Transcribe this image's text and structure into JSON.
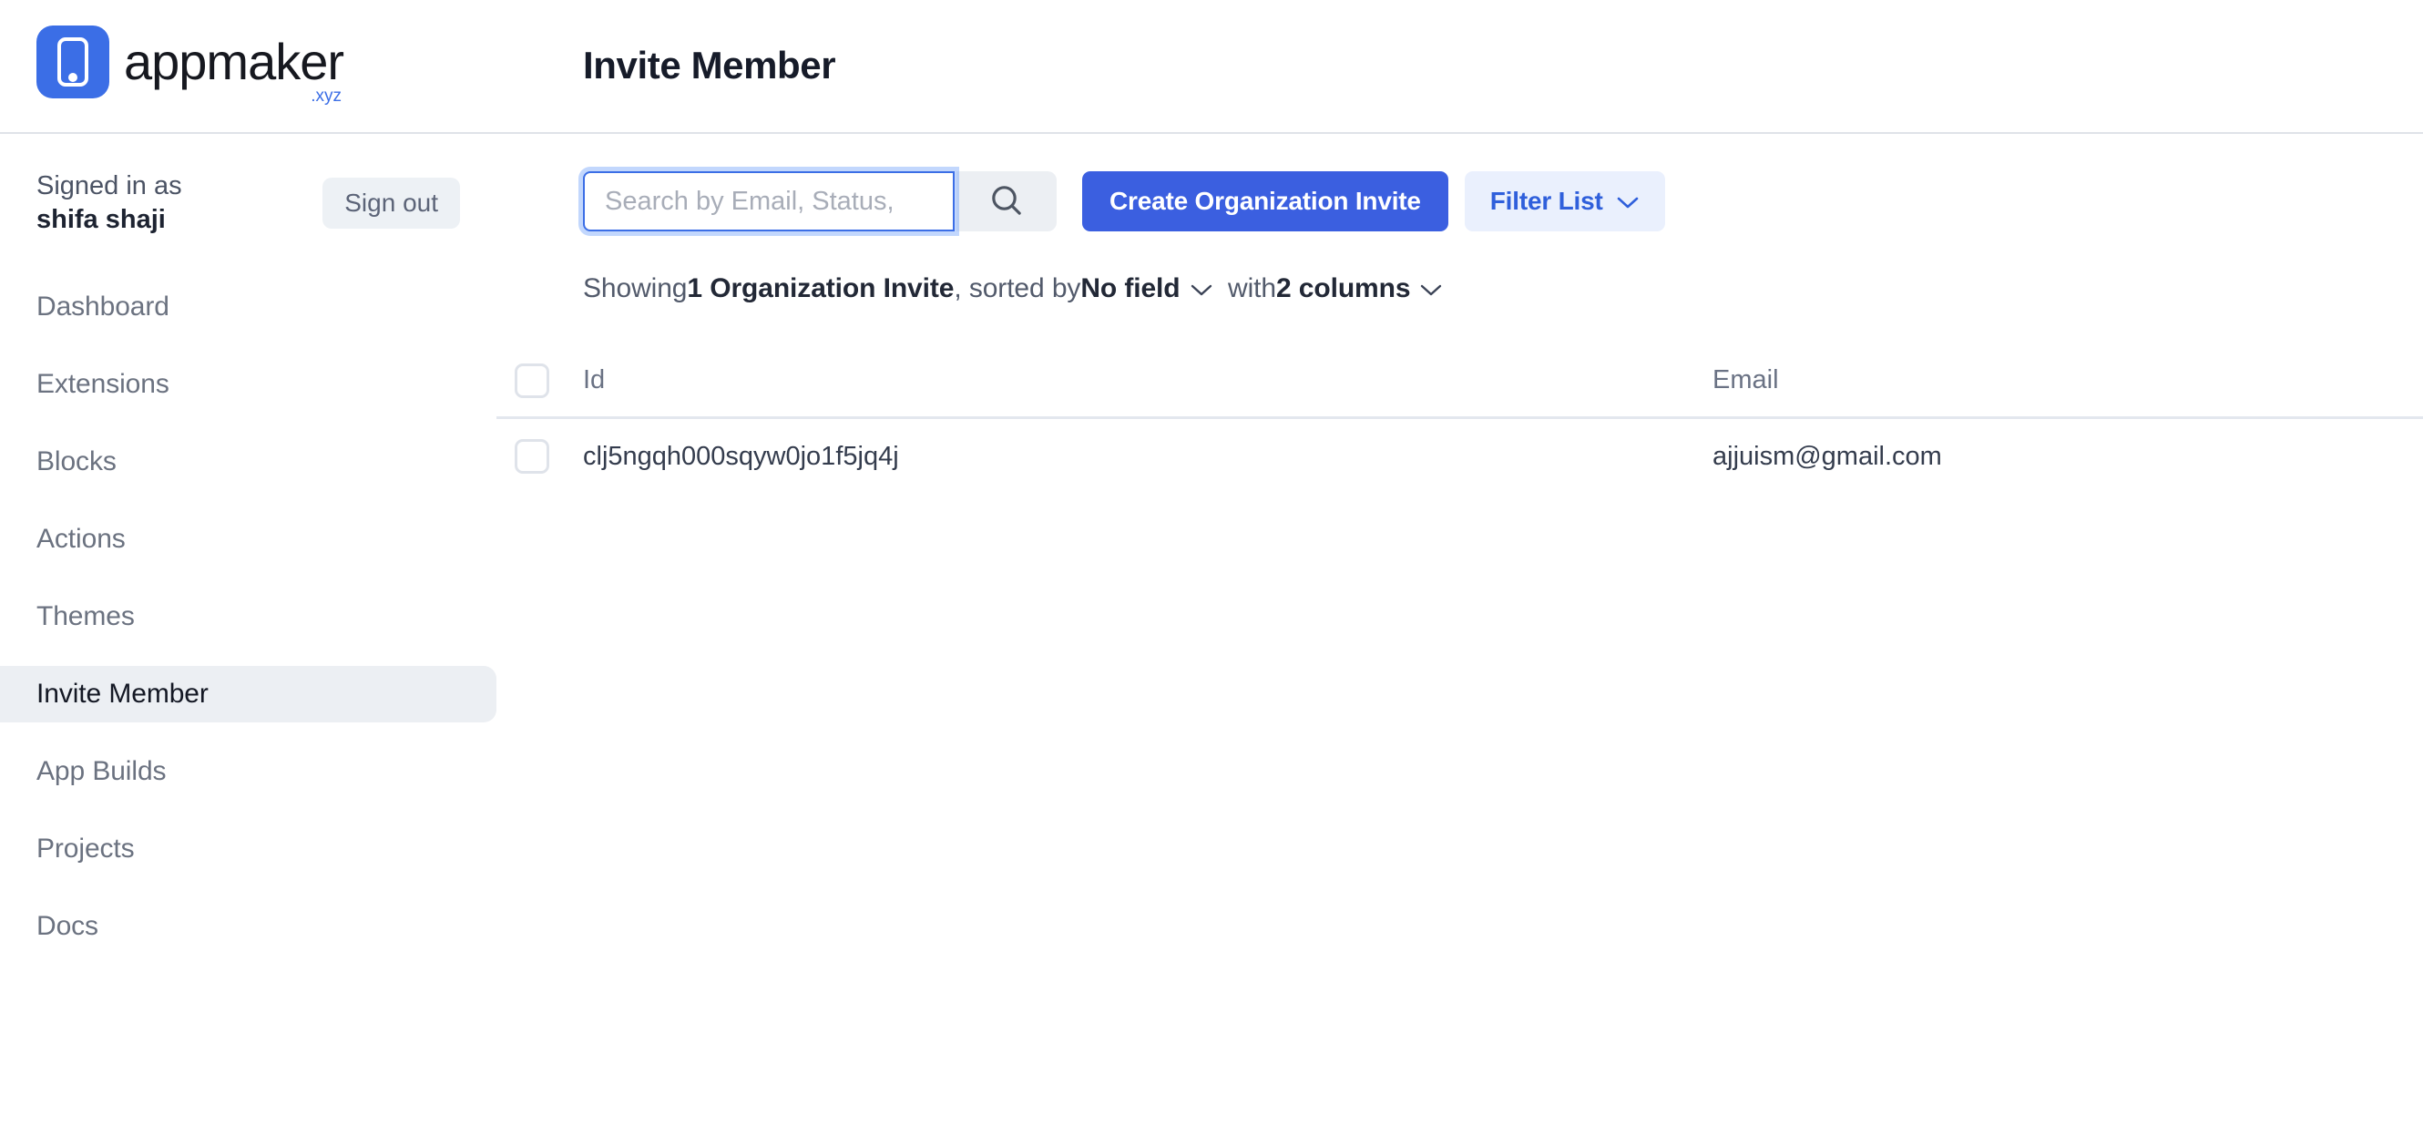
{
  "brand": {
    "name": "appmaker",
    "tld": ".xyz",
    "logo_icon": "phone-icon",
    "accent_color": "#3b6ee6"
  },
  "header": {
    "title": "Invite Member"
  },
  "sidebar": {
    "signed_in_label": "Signed in as",
    "user_name": "shifa shaji",
    "sign_out_label": "Sign out",
    "items": [
      {
        "label": "Dashboard",
        "active": false
      },
      {
        "label": "Extensions",
        "active": false
      },
      {
        "label": "Blocks",
        "active": false
      },
      {
        "label": "Actions",
        "active": false
      },
      {
        "label": "Themes",
        "active": false
      },
      {
        "label": "Invite Member",
        "active": true
      },
      {
        "label": "App Builds",
        "active": false
      },
      {
        "label": "Projects",
        "active": false
      },
      {
        "label": "Docs",
        "active": false
      }
    ]
  },
  "toolbar": {
    "search_placeholder": "Search by Email, Status,",
    "search_value": "",
    "search_icon": "search-icon",
    "create_label": "Create Organization Invite",
    "create_color": "#3b5fe0",
    "filter_label": "Filter List",
    "filter_icon": "chevron-down-icon",
    "filter_color": "#2f5fdb"
  },
  "summary": {
    "prefix": "Showing ",
    "count_label": "1 Organization Invite",
    "sorted_prefix": ", sorted by ",
    "sort_field": "No field",
    "with_label": "with ",
    "columns_label": "2 columns"
  },
  "table": {
    "columns": [
      "Id",
      "Email"
    ],
    "rows": [
      {
        "id": "clj5ngqh000sqyw0jo1f5jq4j",
        "email": "ajjuism@gmail.com",
        "selected": false
      }
    ]
  }
}
